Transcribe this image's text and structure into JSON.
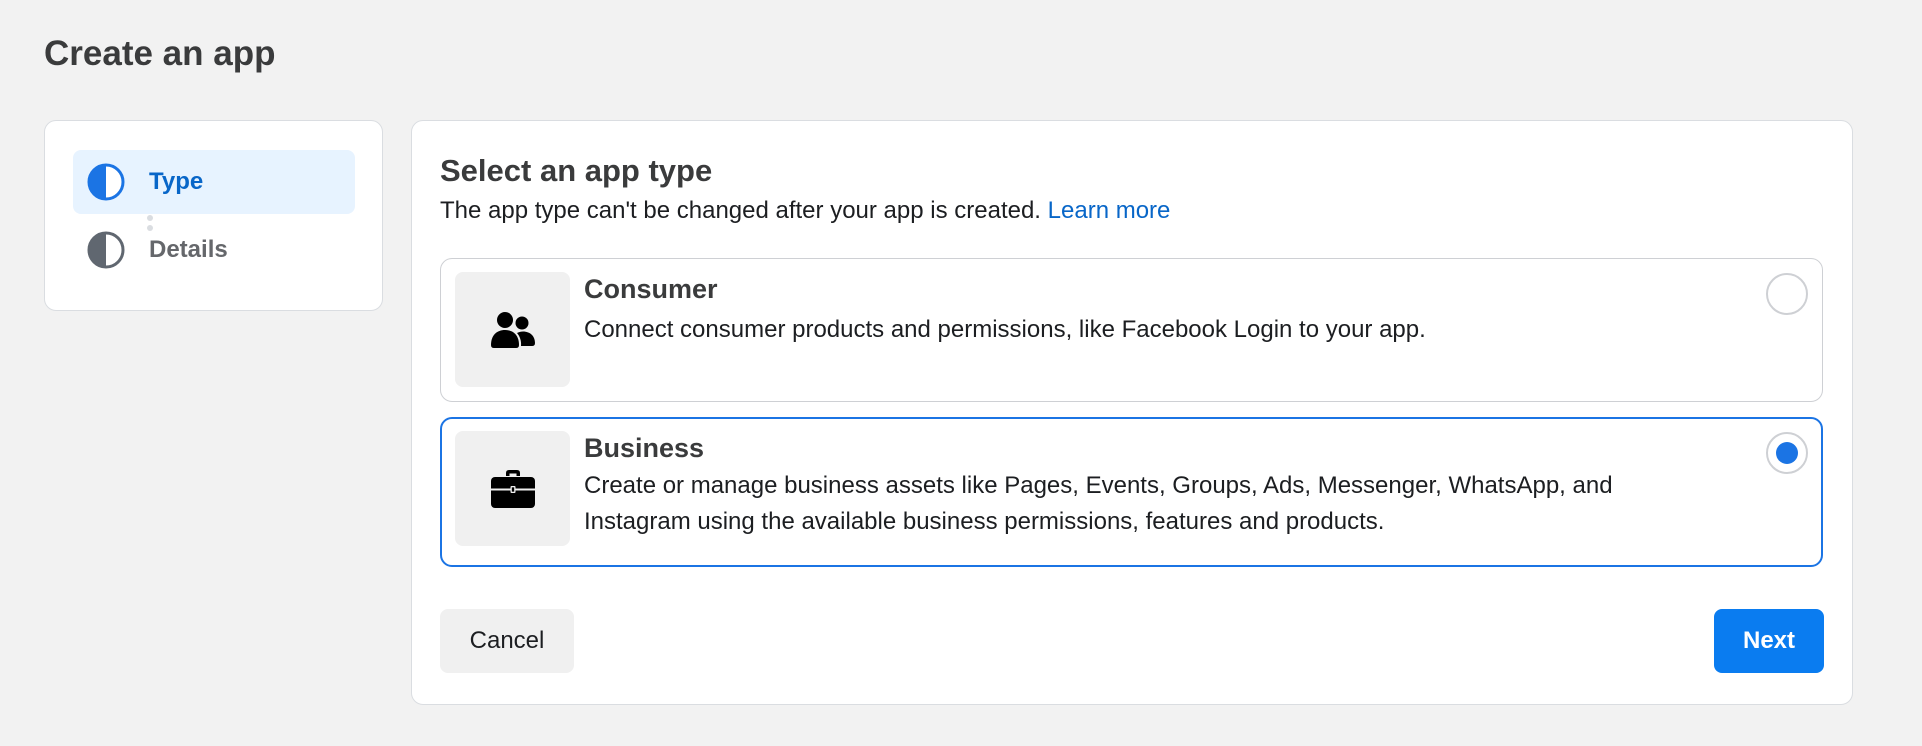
{
  "page": {
    "title": "Create an app"
  },
  "stepper": {
    "steps": [
      {
        "label": "Type",
        "state": "active"
      },
      {
        "label": "Details",
        "state": "inactive"
      }
    ]
  },
  "main": {
    "title": "Select an app type",
    "subtitle": "The app type can't be changed after your app is created.",
    "learn_more": "Learn more",
    "options": [
      {
        "title": "Consumer",
        "description": "Connect consumer products and permissions, like Facebook Login to your app.",
        "icon": "people-icon",
        "selected": false
      },
      {
        "title": "Business",
        "description": "Create or manage business assets like Pages, Events, Groups, Ads, Messenger, WhatsApp, and Instagram using the available business permissions, features and products.",
        "icon": "briefcase-icon",
        "selected": true
      }
    ]
  },
  "actions": {
    "cancel_label": "Cancel",
    "next_label": "Next"
  },
  "colors": {
    "accent": "#1b74e4",
    "primary_button": "#0a7cf0",
    "active_step_bg": "#e7f3ff",
    "link": "#0866c8"
  }
}
